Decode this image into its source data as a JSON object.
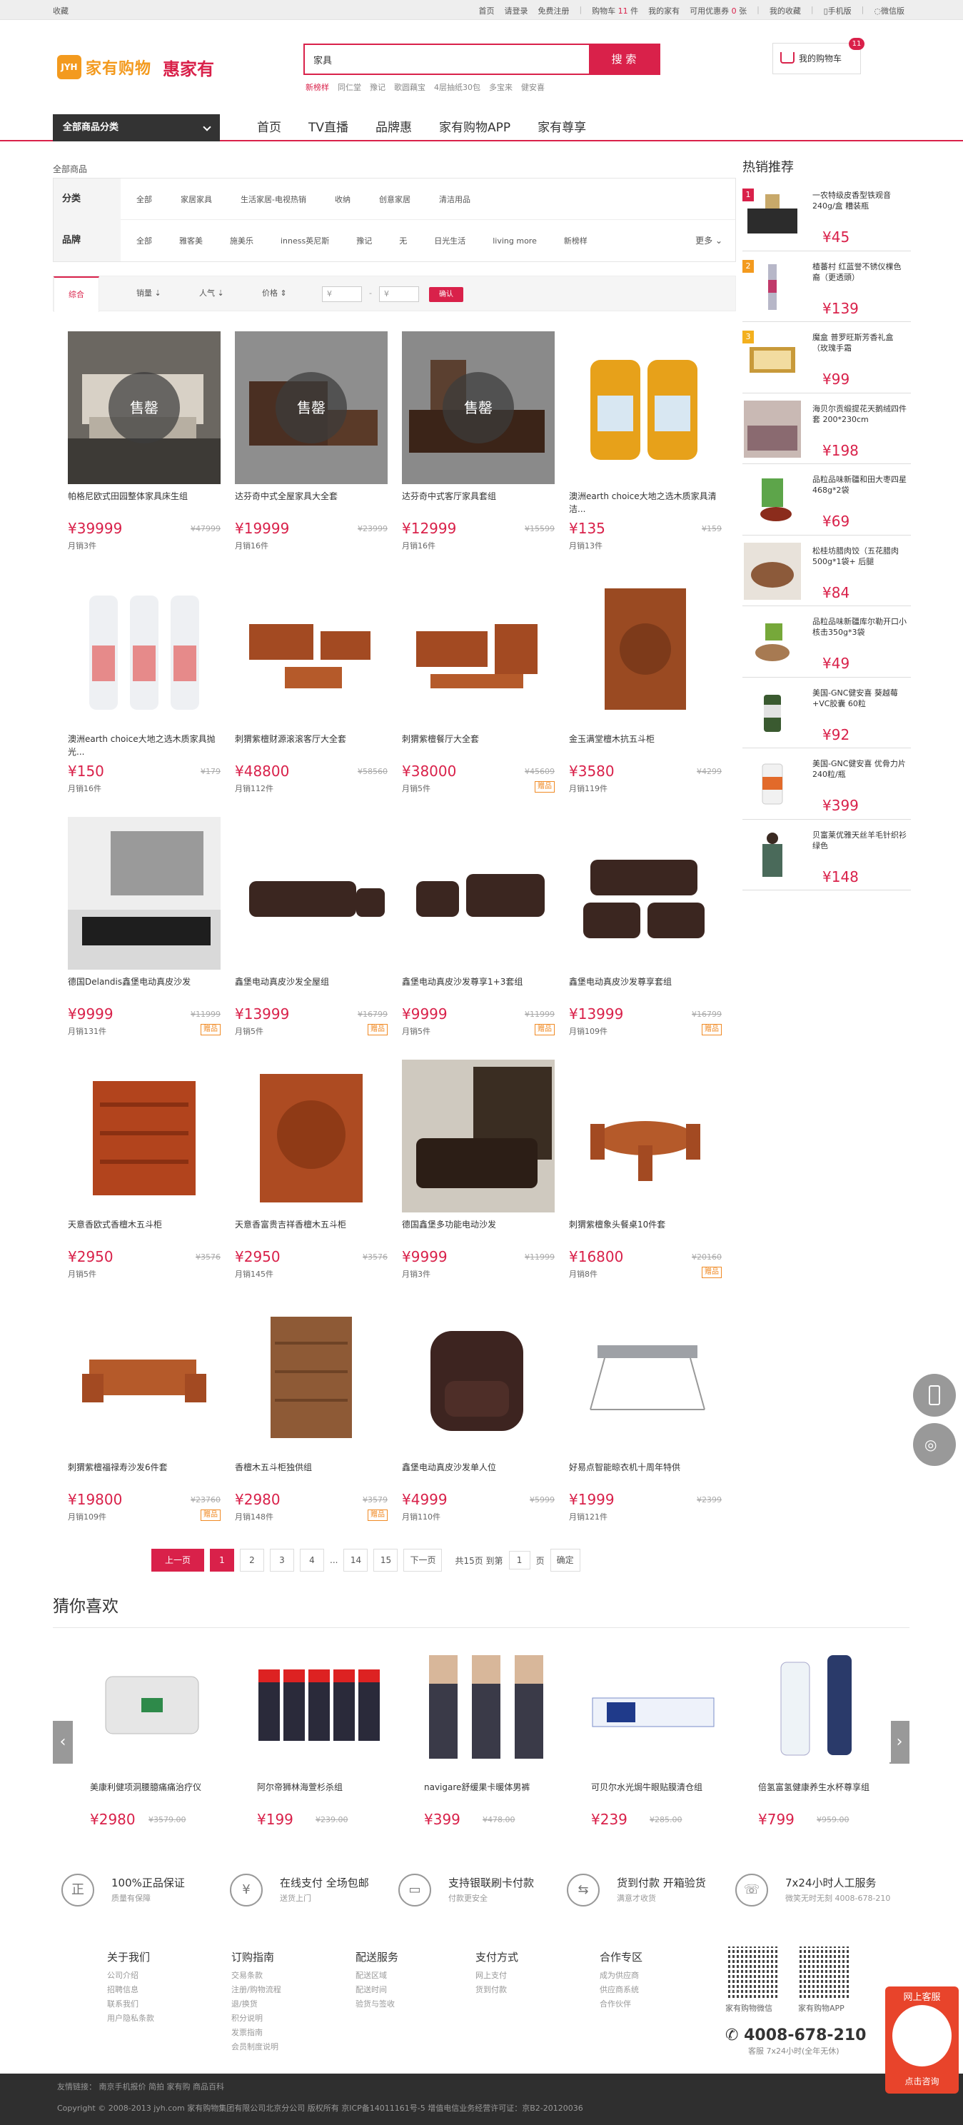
{
  "topbar": {
    "left": "收藏",
    "home": "首页",
    "login": "请登录",
    "register": "免费注册",
    "cart_pre": "购物车",
    "cart_count": "11",
    "cart_unit": "件",
    "myhome": "我的家有",
    "coupon_pre": "可用优惠券",
    "coupon_count": "0",
    "coupon_unit": "张",
    "fav": "我的收藏",
    "mobile": "手机版",
    "weixin": "微信版"
  },
  "logo": {
    "mark": "JYH",
    "name": "家有购物",
    "slogan": "惠家有"
  },
  "search": {
    "value": "家具",
    "button": "搜 索",
    "hotwords": [
      "新榜样",
      "同仁堂",
      "豫记",
      "歌圆藕宝",
      "4层抽纸30包",
      "多宝来",
      "健安喜"
    ]
  },
  "cart": {
    "label": "我的购物车",
    "badge": "11"
  },
  "nav": {
    "category": "全部商品分类",
    "links": [
      "首页",
      "TV直播",
      "品牌惠",
      "家有购物APP",
      "家有尊享"
    ]
  },
  "breadcrumb": "全部商品",
  "filter": {
    "cat_label": "分类",
    "categories": [
      "全部",
      "家居家具",
      "生活家居-电视热销",
      "收纳",
      "创意家居",
      "清洁用品"
    ],
    "brand_label": "品牌",
    "brands": [
      "全部",
      "雅客美",
      "施美乐",
      "inness英尼斯",
      "豫记",
      "无",
      "日光生活",
      "living more",
      "新榜样"
    ],
    "more": "更多"
  },
  "sort": {
    "options": [
      "综合",
      "销量",
      "人气",
      "价格"
    ],
    "price_from": "¥",
    "price_to": "¥",
    "dash": "-",
    "confirm": "确认"
  },
  "products": [
    {
      "name": "帕格尼欧式田园整体家具床生组",
      "price": "¥39999",
      "orig": "¥47999",
      "sold": "月销3件",
      "soldout": "售罄",
      "gift": ""
    },
    {
      "name": "达芬奇中式全屋家具大全套",
      "price": "¥19999",
      "orig": "¥23999",
      "sold": "月销16件",
      "soldout": "售罄",
      "gift": ""
    },
    {
      "name": "达芬奇中式客厅家具套组",
      "price": "¥12999",
      "orig": "¥15599",
      "sold": "月销16件",
      "soldout": "售罄",
      "gift": ""
    },
    {
      "name": "澳洲earth choice大地之选木质家具清洁...",
      "price": "¥135",
      "orig": "¥159",
      "sold": "月销13件",
      "soldout": "",
      "gift": ""
    },
    {
      "name": "澳洲earth choice大地之选木质家具抛光...",
      "price": "¥150",
      "orig": "¥179",
      "sold": "月销16件",
      "soldout": "",
      "gift": ""
    },
    {
      "name": "刺猬紫檀财源滚滚客厅大全套",
      "price": "¥48800",
      "orig": "¥58560",
      "sold": "月销112件",
      "soldout": "",
      "gift": ""
    },
    {
      "name": "刺猬紫檀餐厅大全套",
      "price": "¥38000",
      "orig": "¥45609",
      "sold": "月销5件",
      "soldout": "",
      "gift": "赠品"
    },
    {
      "name": "金玉满堂檀木抗五斗柜",
      "price": "¥3580",
      "orig": "¥4299",
      "sold": "月销119件",
      "soldout": "",
      "gift": ""
    },
    {
      "name": "德国Delandis鑫堡电动真皮沙发",
      "price": "¥9999",
      "orig": "¥11999",
      "sold": "月销131件",
      "soldout": "",
      "gift": "赠品"
    },
    {
      "name": "鑫堡电动真皮沙发全屋组",
      "price": "¥13999",
      "orig": "¥16799",
      "sold": "月销5件",
      "soldout": "",
      "gift": "赠品"
    },
    {
      "name": "鑫堡电动真皮沙发尊享1+3套组",
      "price": "¥9999",
      "orig": "¥11999",
      "sold": "月销5件",
      "soldout": "",
      "gift": "赠品"
    },
    {
      "name": "鑫堡电动真皮沙发尊享套组",
      "price": "¥13999",
      "orig": "¥16799",
      "sold": "月销109件",
      "soldout": "",
      "gift": "赠品"
    },
    {
      "name": "天意香欧式香檀木五斗柜",
      "price": "¥2950",
      "orig": "¥3576",
      "sold": "月销5件",
      "soldout": "",
      "gift": ""
    },
    {
      "name": "天意香富贵吉祥香檀木五斗柜",
      "price": "¥2950",
      "orig": "¥3576",
      "sold": "月销145件",
      "soldout": "",
      "gift": ""
    },
    {
      "name": "德国鑫堡多功能电动沙发",
      "price": "¥9999",
      "orig": "¥11999",
      "sold": "月销3件",
      "soldout": "",
      "gift": ""
    },
    {
      "name": "刺猬紫檀象头餐桌10件套",
      "price": "¥16800",
      "orig": "¥20160",
      "sold": "月销8件",
      "soldout": "",
      "gift": "赠品"
    },
    {
      "name": "刺猬紫檀福禄寿沙发6件套",
      "price": "¥19800",
      "orig": "¥23760",
      "sold": "月销109件",
      "soldout": "",
      "gift": "赠品"
    },
    {
      "name": "香檀木五斗柜独供组",
      "price": "¥2980",
      "orig": "¥3579",
      "sold": "月销148件",
      "soldout": "",
      "gift": "赠品"
    },
    {
      "name": "鑫堡电动真皮沙发单人位",
      "price": "¥4999",
      "orig": "¥5999",
      "sold": "月销110件",
      "soldout": "",
      "gift": ""
    },
    {
      "name": "好易点智能晾衣机十周年特供",
      "price": "¥1999",
      "orig": "¥2399",
      "sold": "月销121件",
      "soldout": "",
      "gift": ""
    }
  ],
  "pager": {
    "prev": "上一页",
    "pages": [
      "1",
      "2",
      "3",
      "4"
    ],
    "dots": "...",
    "p14": "14",
    "p15": "15",
    "next": "下一页",
    "total": "共15页 到第",
    "jump": "1",
    "page_unit": "页",
    "confirm": "确定"
  },
  "sidebar": {
    "title": "热销推荐",
    "items": [
      {
        "rank": "1",
        "title": "一农特级皮香型铁观音240g/盒 糟装瓶",
        "price": "¥45"
      },
      {
        "rank": "2",
        "title": "楂蕃村 红蓝誉不锈仪棵色裔（更透頭）",
        "price": "¥139"
      },
      {
        "rank": "3",
        "title": "魔盒 普罗旺斯芳香礼盒（玫瑰手霜",
        "price": "¥99"
      },
      {
        "rank": "",
        "title": "海贝尔贡缎提花天鹅绒四件套 200*230cm",
        "price": "¥198"
      },
      {
        "rank": "",
        "title": "品粒品味新疆和田大枣四星468g*2袋",
        "price": "¥69"
      },
      {
        "rank": "",
        "title": "松桂坊腊肉饺（五花腊肉500g*1袋+ 后腿",
        "price": "¥84"
      },
      {
        "rank": "",
        "title": "品粒品味新疆库尔勒开口小核击350g*3袋",
        "price": "¥49"
      },
      {
        "rank": "",
        "title": "美国-GNC健安喜 葵越莓+VC胶囊 60粒",
        "price": "¥92"
      },
      {
        "rank": "",
        "title": "美国-GNC健安喜 优骨力片 240粒/瓶",
        "price": "¥399"
      },
      {
        "rank": "",
        "title": "贝富莱优雅天丝羊毛针织衫 绿色",
        "price": "¥148"
      }
    ]
  },
  "guess": {
    "title": "猜你喜欢",
    "items": [
      {
        "name": "美康利健项洞腰臆痛痛治疗仪",
        "price": "¥2980",
        "orig": "¥3579.00"
      },
      {
        "name": "阿尔帝狮林海萱杉杀组",
        "price": "¥199",
        "orig": "¥239.00"
      },
      {
        "name": "navigare舒缓果卡暖体男裤",
        "price": "¥399",
        "orig": "¥478.00"
      },
      {
        "name": "可贝尔水光焗牛眼贴膜清仓组",
        "price": "¥239",
        "orig": "¥285.00"
      },
      {
        "name": "倍氢富氢健康养生水杯尊享组",
        "price": "¥799",
        "orig": "¥959.00"
      }
    ]
  },
  "guarantee": [
    {
      "icon": "正",
      "a": "100%正品保证",
      "b": "质量有保障"
    },
    {
      "icon": "¥",
      "a": "在线支付 全场包邮",
      "b": "送货上门"
    },
    {
      "icon": "▭",
      "a": "支持银联刷卡付款",
      "b": "付款更安全"
    },
    {
      "icon": "⇆",
      "a": "货到付款 开箱验货",
      "b": "满意才收货"
    },
    {
      "icon": "☏",
      "a": "7x24小时人工服务",
      "b": "微笑无时无刻 4008-678-210"
    }
  ],
  "footer": {
    "cols": [
      {
        "h": "关于我们",
        "items": [
          "公司介绍",
          "招聘信息",
          "联系我们",
          "用户隐私条款"
        ]
      },
      {
        "h": "订购指南",
        "items": [
          "交易条款",
          "注册/购物流程",
          "退/换货",
          "积分说明",
          "发票指南",
          "会员制度说明"
        ]
      },
      {
        "h": "配送服务",
        "items": [
          "配送区域",
          "配送时间",
          "验货与签收"
        ]
      },
      {
        "h": "支付方式",
        "items": [
          "网上支付",
          "货到付款"
        ]
      },
      {
        "h": "合作专区",
        "items": [
          "成为供应商",
          "供应商系统",
          "合作伙伴"
        ]
      }
    ],
    "qr1": "家有购物微信",
    "qr2": "家有购物APP",
    "hotline": "4008-678-210",
    "hotline2": "客服 7x24小时(全年无休)",
    "links": "友情链接：  南京手机报价  简拍  家有购  商品百科",
    "copyright": "Copyright © 2008-2013 jyh.com 家有购物集团有限公司北京分公司 版权所有 京ICP备14011161号-5  增值电信业务经营许可证：京B2-20120036"
  },
  "service": {
    "top": "网上客服",
    "bottom": "点击咨询"
  }
}
